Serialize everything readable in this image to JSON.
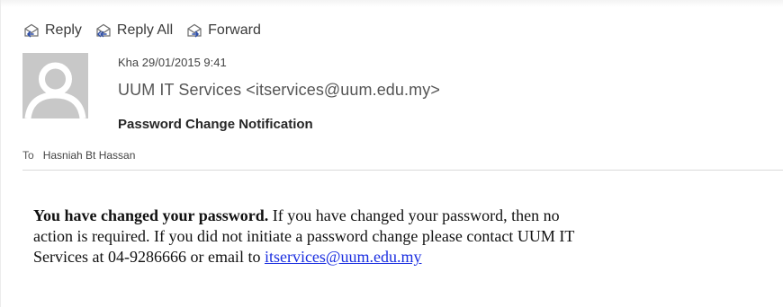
{
  "toolbar": {
    "reply_label": "Reply",
    "reply_all_label": "Reply All",
    "forward_label": "Forward"
  },
  "message": {
    "sent_datetime": "Kha 29/01/2015 9:41",
    "sender": "UUM IT Services <itservices@uum.edu.my>",
    "subject": "Password Change Notification",
    "to_label": "To",
    "recipient": "Hasniah Bt Hassan",
    "body": {
      "headline": "You have changed your password.",
      "line1": " If you have changed your password, then no",
      "line2": "action is required. If you did not initiate a password change please contact UUM IT",
      "line3_prefix": "Services at 04-9286666 or email to ",
      "email_link": "itservices@uum.edu.my"
    }
  },
  "icons": {
    "reply": "reply-icon",
    "reply_all": "reply-all-icon",
    "forward": "forward-icon",
    "avatar": "avatar-placeholder"
  },
  "colors": {
    "link": "#1a2ee0",
    "avatar_bg": "#c8c8c8",
    "icon_accent": "#2f4fa8"
  }
}
